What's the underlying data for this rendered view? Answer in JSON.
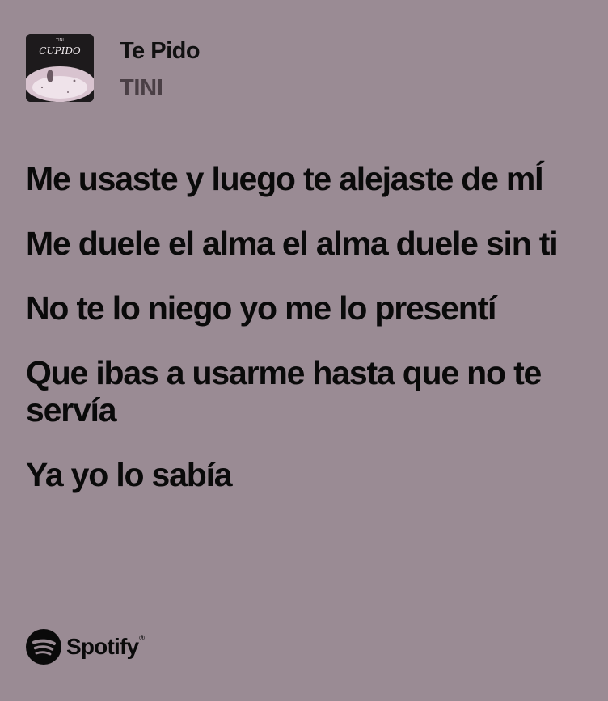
{
  "track": {
    "title": "Te Pido",
    "artist": "TINI"
  },
  "cover": {
    "label": "CUPIDO",
    "small_text": "TINI"
  },
  "lyrics": [
    "Me usaste y luego te alejaste de mÍ",
    "Me duele el alma el alma duele sin ti",
    "No te lo niego yo me lo presentí",
    "Que ibas a usarme hasta que no te servía",
    "Ya yo lo sabía"
  ],
  "brand": {
    "name": "Spotify",
    "trademark": "®",
    "icon": "spotify-logo-icon"
  },
  "colors": {
    "background": "#9a8b94",
    "text": "#0a0a0a",
    "artist": "#4a3f45"
  }
}
